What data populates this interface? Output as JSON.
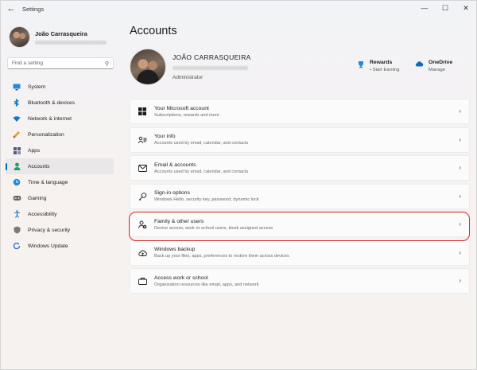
{
  "window": {
    "title": "Settings",
    "back_icon": "back-arrow-icon",
    "controls": [
      "minimize",
      "maximize",
      "close"
    ]
  },
  "sidebar": {
    "profile_name": "João Carrasqueira",
    "search_placeholder": "Find a setting",
    "items": [
      {
        "label": "System",
        "icon": "monitor-icon",
        "color": "#0078d4"
      },
      {
        "label": "Bluetooth & devices",
        "icon": "bluetooth-icon",
        "color": "#0078d4"
      },
      {
        "label": "Network & internet",
        "icon": "wifi-icon",
        "color": "#0078d4"
      },
      {
        "label": "Personalization",
        "icon": "brush-icon",
        "color": "#d28a3a"
      },
      {
        "label": "Apps",
        "icon": "apps-icon",
        "color": "#4a4a6a"
      },
      {
        "label": "Accounts",
        "icon": "person-icon",
        "color": "#1e9e6a",
        "active": true
      },
      {
        "label": "Time & language",
        "icon": "globe-clock-icon",
        "color": "#0078d4"
      },
      {
        "label": "Gaming",
        "icon": "gamepad-icon",
        "color": "#555"
      },
      {
        "label": "Accessibility",
        "icon": "accessibility-icon",
        "color": "#0078d4"
      },
      {
        "label": "Privacy & security",
        "icon": "shield-icon",
        "color": "#666"
      },
      {
        "label": "Windows Update",
        "icon": "update-icon",
        "color": "#0078d4"
      }
    ]
  },
  "main": {
    "page_title": "Accounts",
    "user_name": "JOÃO CARRASQUEIRA",
    "user_role": "Administrator",
    "rewards": {
      "title": "Rewards",
      "subtitle": "• Start Earning"
    },
    "onedrive": {
      "title": "OneDrive",
      "subtitle": "Manage"
    },
    "cards": [
      {
        "title": "Your Microsoft account",
        "desc": "Subscriptions, rewards and more",
        "icon": "microsoft-logo-icon"
      },
      {
        "title": "Your info",
        "desc": "Accounts used by email, calendar, and contacts",
        "icon": "person-card-icon"
      },
      {
        "title": "Email & accounts",
        "desc": "Accounts used by email, calendar, and contacts",
        "icon": "mail-icon"
      },
      {
        "title": "Sign-in options",
        "desc": "Windows Hello, security key, password, dynamic lock",
        "icon": "key-icon"
      },
      {
        "title": "Family & other users",
        "desc": "Device access, work or school users, kiosk assigned access",
        "icon": "add-users-icon"
      },
      {
        "title": "Windows backup",
        "desc": "Back up your files, apps, preferences to restore them across devices",
        "icon": "backup-icon"
      },
      {
        "title": "Access work or school",
        "desc": "Organization resources like email, apps, and network",
        "icon": "briefcase-icon"
      }
    ]
  },
  "colors": {
    "accent": "#0067c0",
    "highlight": "#d42a2a"
  }
}
